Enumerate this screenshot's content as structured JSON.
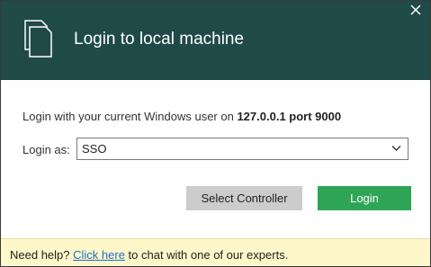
{
  "dialog": {
    "title": "Login to local machine",
    "close_icon": "close-icon",
    "header_icon": "documents-icon"
  },
  "info": {
    "prefix": "Login with your current Windows user on ",
    "address": "127.0.0.1 port 9000"
  },
  "login_as": {
    "label": "Login as:",
    "selected": "SSO",
    "icon": "chevron-down-icon"
  },
  "buttons": {
    "secondary_label": "Select Controller",
    "primary_label": "Login"
  },
  "footer": {
    "prefix": "Need help? ",
    "link_text": "Click here",
    "suffix": " to chat with one of our experts."
  },
  "colors": {
    "header_bg": "#1f4a48",
    "primary_button": "#2ea556",
    "secondary_button": "#cccccc",
    "footer_bg": "#fdf7c9",
    "link": "#1f6fc7"
  }
}
